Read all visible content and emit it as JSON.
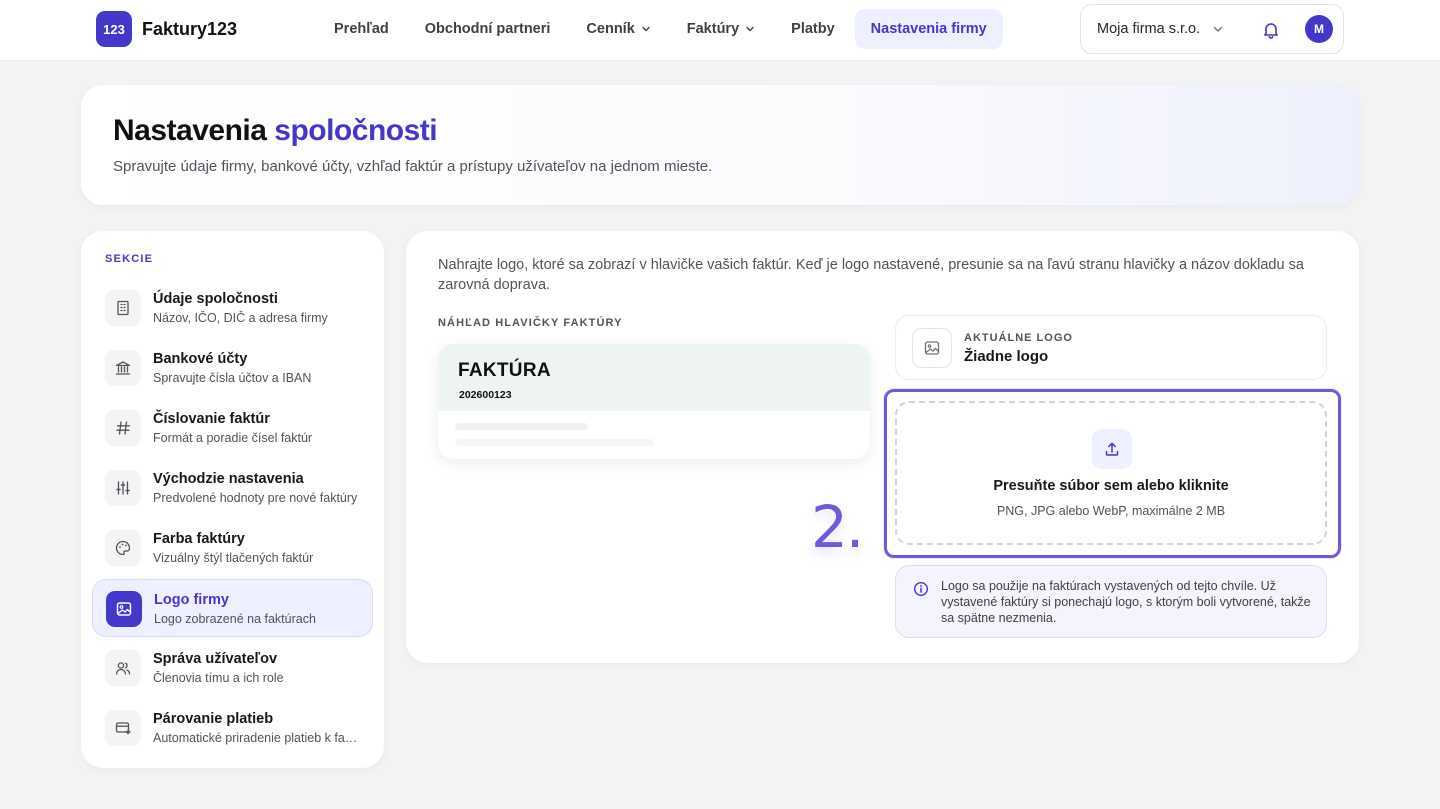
{
  "brand": {
    "badge": "123",
    "name": "Faktury123"
  },
  "nav": {
    "items": [
      {
        "label": "Prehľad"
      },
      {
        "label": "Obchodní partneri"
      },
      {
        "label": "Cenník"
      },
      {
        "label": "Faktúry"
      },
      {
        "label": "Platby"
      },
      {
        "label": "Nastavenia firmy"
      }
    ],
    "active": "Nastavenia firmy"
  },
  "account": {
    "company": "Moja firma s.r.o.",
    "avatar_initial": "M"
  },
  "hero": {
    "title_part1": "Nastavenia ",
    "title_part2": "spoločnosti",
    "subtitle": "Spravujte údaje firmy, bankové účty, vzhľad faktúr a prístupy užívateľov na jednom mieste."
  },
  "sidebar": {
    "heading": "SEKCIE",
    "items": [
      {
        "label": "Údaje spoločnosti",
        "desc": "Názov, IČO, DIČ a adresa firmy",
        "icon": "building-icon"
      },
      {
        "label": "Bankové účty",
        "desc": "Spravujte čísla účtov a IBAN",
        "icon": "bank-icon"
      },
      {
        "label": "Číslovanie faktúr",
        "desc": "Formát a poradie čísel faktúr",
        "icon": "hash-icon"
      },
      {
        "label": "Východzie nastavenia",
        "desc": "Predvolené hodnoty pre nové faktúry",
        "icon": "sliders-icon"
      },
      {
        "label": "Farba faktúry",
        "desc": "Vizuálny štýl tlačených faktúr",
        "icon": "palette-icon"
      },
      {
        "label": "Logo firmy",
        "desc": "Logo zobrazené na faktúrach",
        "icon": "image-icon"
      },
      {
        "label": "Správa užívateľov",
        "desc": "Členovia tímu a ich role",
        "icon": "users-icon"
      },
      {
        "label": "Párovanie platieb",
        "desc": "Automatické priradenie platieb k faktúram",
        "icon": "card-sync-icon"
      }
    ],
    "active": "Logo firmy"
  },
  "main": {
    "intro": "Nahrajte logo, ktoré sa zobrazí v hlavičke vašich faktúr. Keď je logo nastavené, presunie sa na ľavú stranu hlavičky a názov dokladu sa zarovná doprava.",
    "preview_label": "NÁHĽAD HLAVIČKY FAKTÚRY",
    "preview": {
      "title": "FAKTÚRA",
      "number": "202600123"
    },
    "current_logo": {
      "label": "AKTUÁLNE LOGO",
      "value": "Žiadne logo"
    },
    "dropzone": {
      "title": "Presuňte súbor sem alebo kliknite",
      "subtitle": "PNG, JPG alebo WebP, maximálne 2 MB"
    },
    "step_marker": "2.",
    "info": "Logo sa použije na faktúrach vystavených od tejto chvíle. Už vystavené faktúry si ponechajú logo, s ktorým boli vytvorené, takže sa spätne nezmenia."
  },
  "colors": {
    "accent": "#4338ca",
    "highlight": "#6d5bd9",
    "preview_header": "#eef5f1"
  }
}
